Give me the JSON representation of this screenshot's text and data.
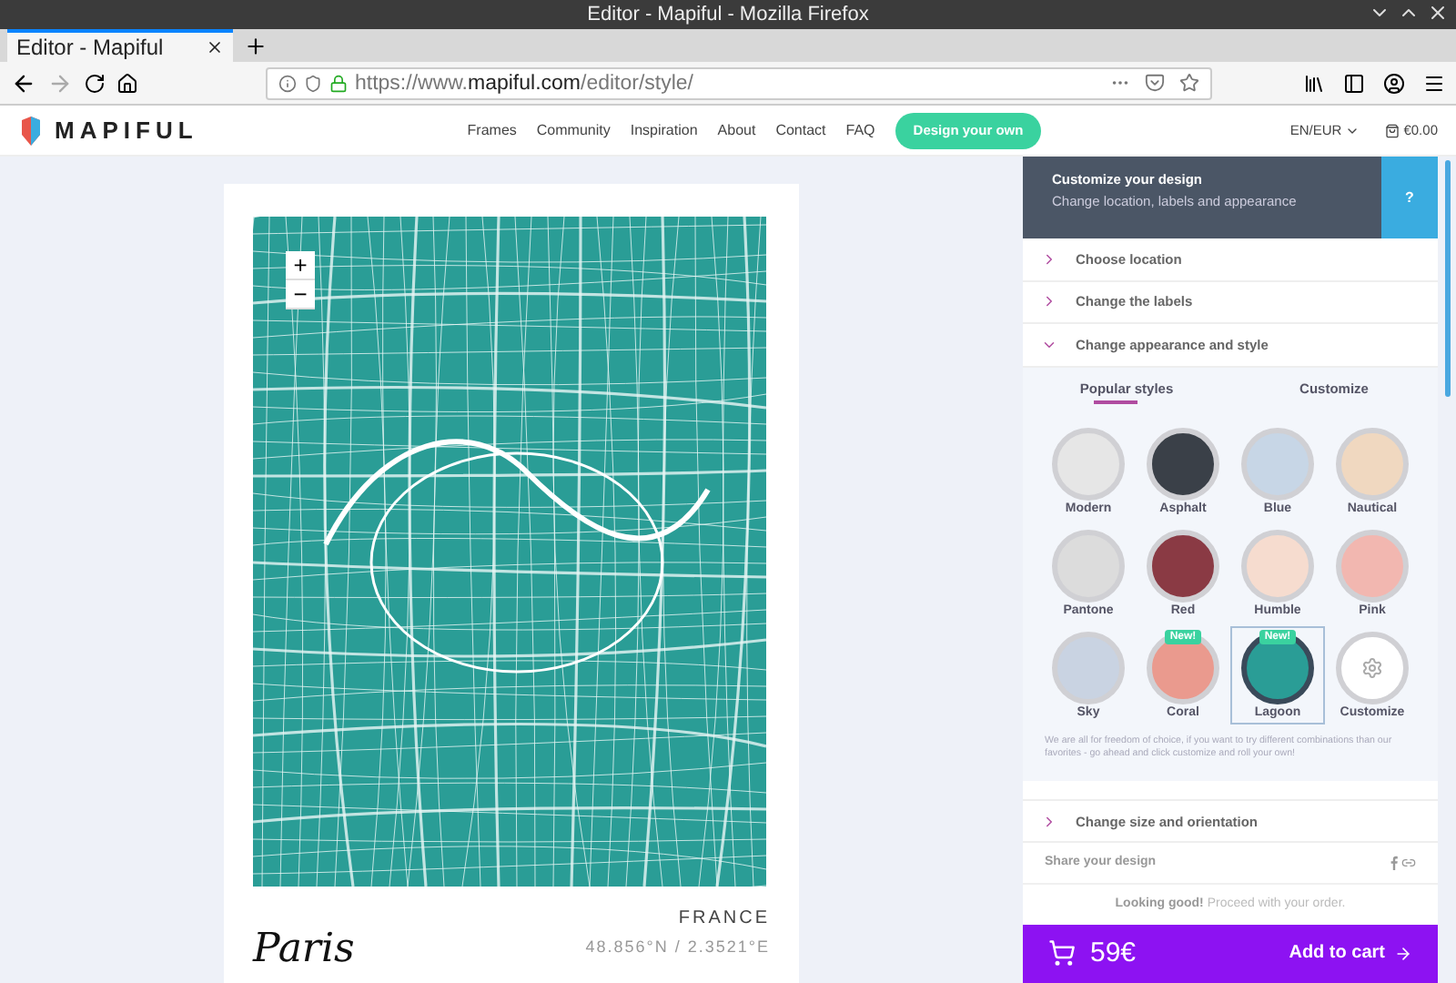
{
  "window": {
    "title": "Editor - Mapiful - Mozilla Firefox"
  },
  "tabs": [
    {
      "label": "Editor - Mapiful",
      "selected": true
    }
  ],
  "address_bar": {
    "url_prefix": "https://www.",
    "url_domain": "mapiful.com",
    "url_path": "/editor/style/"
  },
  "site_nav": {
    "logo": "MAPIFUL",
    "links": [
      "Frames",
      "Community",
      "Inspiration",
      "About",
      "Contact",
      "FAQ"
    ],
    "cta": "Design your own",
    "locale": "EN/EUR",
    "cart": "€0.00"
  },
  "poster": {
    "zoom_in": "+",
    "zoom_out": "−",
    "city": "Paris",
    "country": "FRANCE",
    "coordinates": "48.856°N / 2.3521°E"
  },
  "panel": {
    "title": "Customize your design",
    "subtitle": "Change location, labels and appearance",
    "help": "?",
    "sections": [
      {
        "label": "Choose location",
        "expanded": false
      },
      {
        "label": "Change the labels",
        "expanded": false
      },
      {
        "label": "Change appearance and style",
        "expanded": true
      }
    ],
    "style_tabs": [
      {
        "label": "Popular styles",
        "selected": true
      },
      {
        "label": "Customize",
        "selected": false
      }
    ],
    "styles": [
      {
        "name": "Modern",
        "kind": "map",
        "color": "#e6e6e6",
        "selected": false
      },
      {
        "name": "Asphalt",
        "kind": "map",
        "color": "#3a4048",
        "selected": false
      },
      {
        "name": "Blue",
        "kind": "map",
        "color": "#c7d6e6",
        "selected": false
      },
      {
        "name": "Nautical",
        "kind": "map",
        "color": "#f0d8c0",
        "selected": false
      },
      {
        "name": "Pantone",
        "kind": "map",
        "color": "#dcdcdc",
        "selected": false
      },
      {
        "name": "Red",
        "kind": "map",
        "color": "#8a3a44",
        "selected": false
      },
      {
        "name": "Humble",
        "kind": "map",
        "color": "#f6dccf",
        "selected": false
      },
      {
        "name": "Pink",
        "kind": "map",
        "color": "#f2b7b0",
        "selected": false
      },
      {
        "name": "Sky",
        "kind": "map",
        "color": "#c9d3e2",
        "selected": false
      },
      {
        "name": "Coral",
        "kind": "map",
        "color": "#ea9a8e",
        "selected": false,
        "badge": "New!"
      },
      {
        "name": "Lagoon",
        "kind": "map",
        "color": "#2a9d96",
        "selected": true,
        "badge": "New!"
      },
      {
        "name": "Customize",
        "kind": "custom",
        "selected": false
      }
    ],
    "note": "We are all for freedom of choice, if you want to try different combinations than our favorites - go ahead and click customize and roll your own!",
    "size_section": {
      "label": "Change size and orientation",
      "expanded": false
    },
    "share": "Share your design",
    "looking_good": "**Looking good!** Proceed with your order.",
    "price": "59€",
    "add_to_cart": "Add to cart"
  }
}
